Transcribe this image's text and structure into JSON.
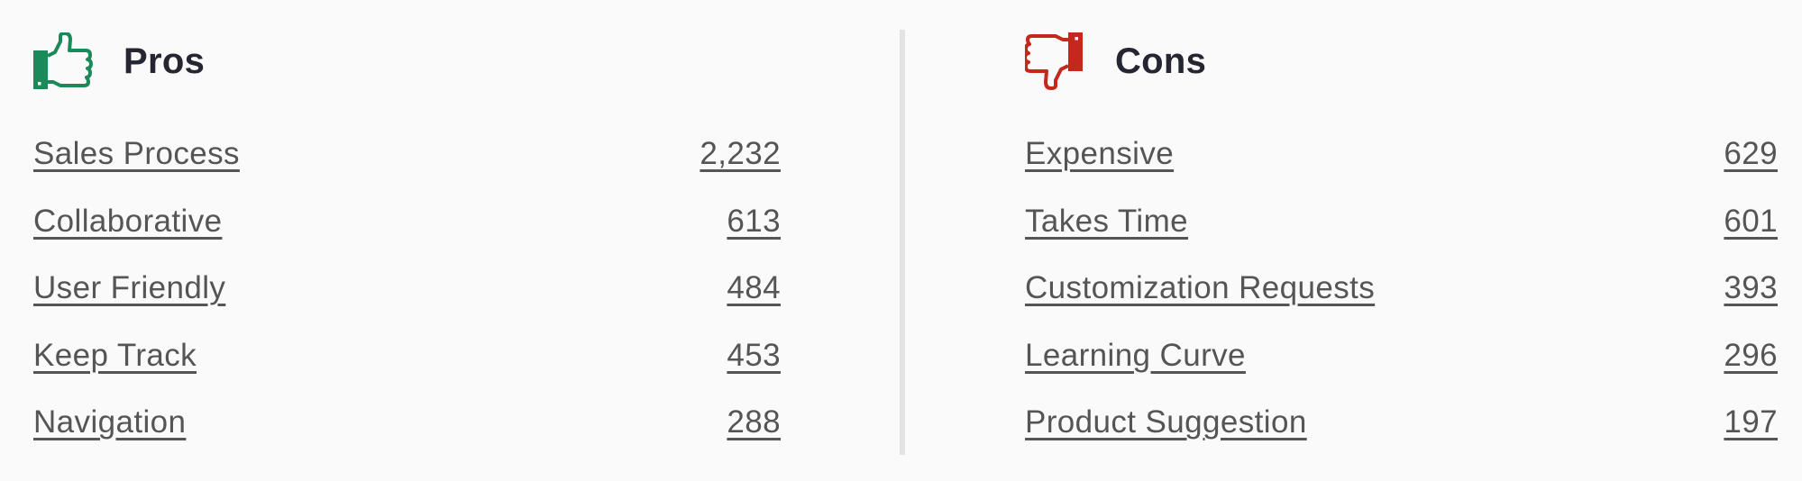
{
  "colors": {
    "pros_icon": "#1b8a5a",
    "cons_icon": "#c4281c",
    "title_text": "#262632",
    "link_text": "#555555",
    "divider": "#e3e3e3"
  },
  "pros": {
    "icon": "thumbs-up-icon",
    "title": "Pros",
    "items": [
      {
        "label": "Sales Process",
        "count": "2,232"
      },
      {
        "label": "Collaborative",
        "count": "613"
      },
      {
        "label": "User Friendly",
        "count": "484"
      },
      {
        "label": "Keep Track",
        "count": "453"
      },
      {
        "label": "Navigation",
        "count": "288"
      }
    ]
  },
  "cons": {
    "icon": "thumbs-down-icon",
    "title": "Cons",
    "items": [
      {
        "label": "Expensive",
        "count": "629"
      },
      {
        "label": "Takes Time",
        "count": "601"
      },
      {
        "label": "Customization Requests",
        "count": "393"
      },
      {
        "label": "Learning Curve",
        "count": "296"
      },
      {
        "label": "Product Suggestion",
        "count": "197"
      }
    ]
  }
}
